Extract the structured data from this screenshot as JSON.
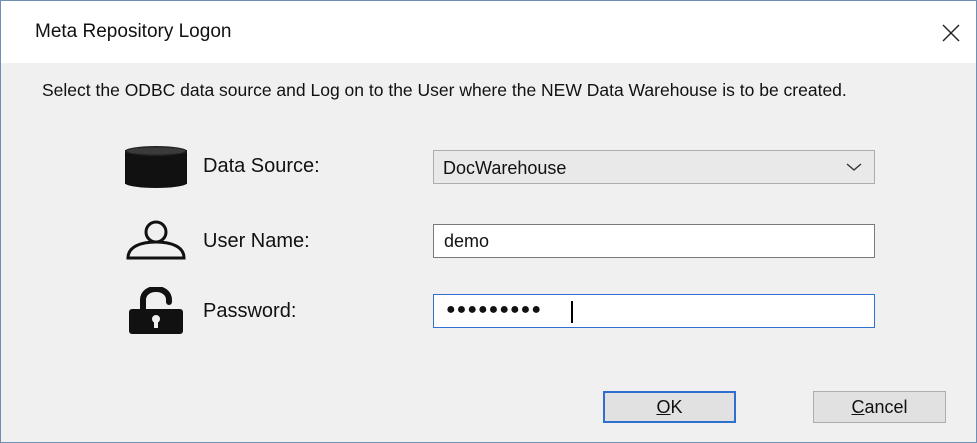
{
  "window": {
    "title": "Meta Repository Logon",
    "close_glyph": "✕"
  },
  "instructions": "Select the ODBC data source and Log on to the User where the NEW Data Warehouse is to be created.",
  "fields": {
    "data_source": {
      "label": "Data Source:",
      "value": "DocWarehouse",
      "icon": "database-icon"
    },
    "user_name": {
      "label": "User Name:",
      "value": "demo",
      "icon": "user-icon"
    },
    "password": {
      "label": "Password:",
      "masked_value": "●●●●●●●●●",
      "icon": "unlocked-padlock-icon"
    }
  },
  "buttons": {
    "ok": {
      "mnemonic": "O",
      "rest": "K"
    },
    "cancel": {
      "mnemonic": "C",
      "rest": "ancel"
    }
  },
  "colors": {
    "focus_border": "#2f6fd0",
    "dialog_background": "#f0f0f0",
    "titlebar_background": "#ffffff"
  }
}
